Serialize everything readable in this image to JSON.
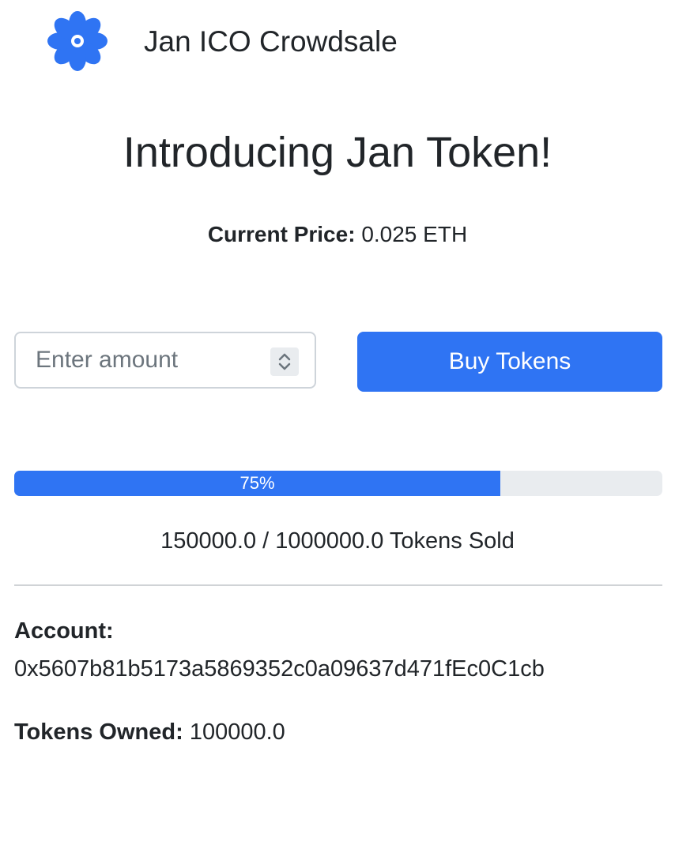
{
  "header": {
    "brand_title": "Jan ICO Crowdsale",
    "logo_icon": "flower-icon",
    "accent_color": "#2f74f3"
  },
  "main": {
    "title": "Introducing Jan Token!",
    "price_label": "Current Price:",
    "price_value": "0.025 ETH",
    "amount_input": {
      "value": "",
      "placeholder": "Enter amount"
    },
    "buy_button_label": "Buy Tokens",
    "progress": {
      "percent": 75,
      "label": "75%"
    },
    "tokens_sold_text": "150000.0 / 1000000.0 Tokens Sold"
  },
  "account": {
    "label": "Account:",
    "address": "0x5607b81b5173a5869352c0a09637d471fEc0C1cb",
    "tokens_owned_label": "Tokens Owned:",
    "tokens_owned_value": "100000.0"
  }
}
